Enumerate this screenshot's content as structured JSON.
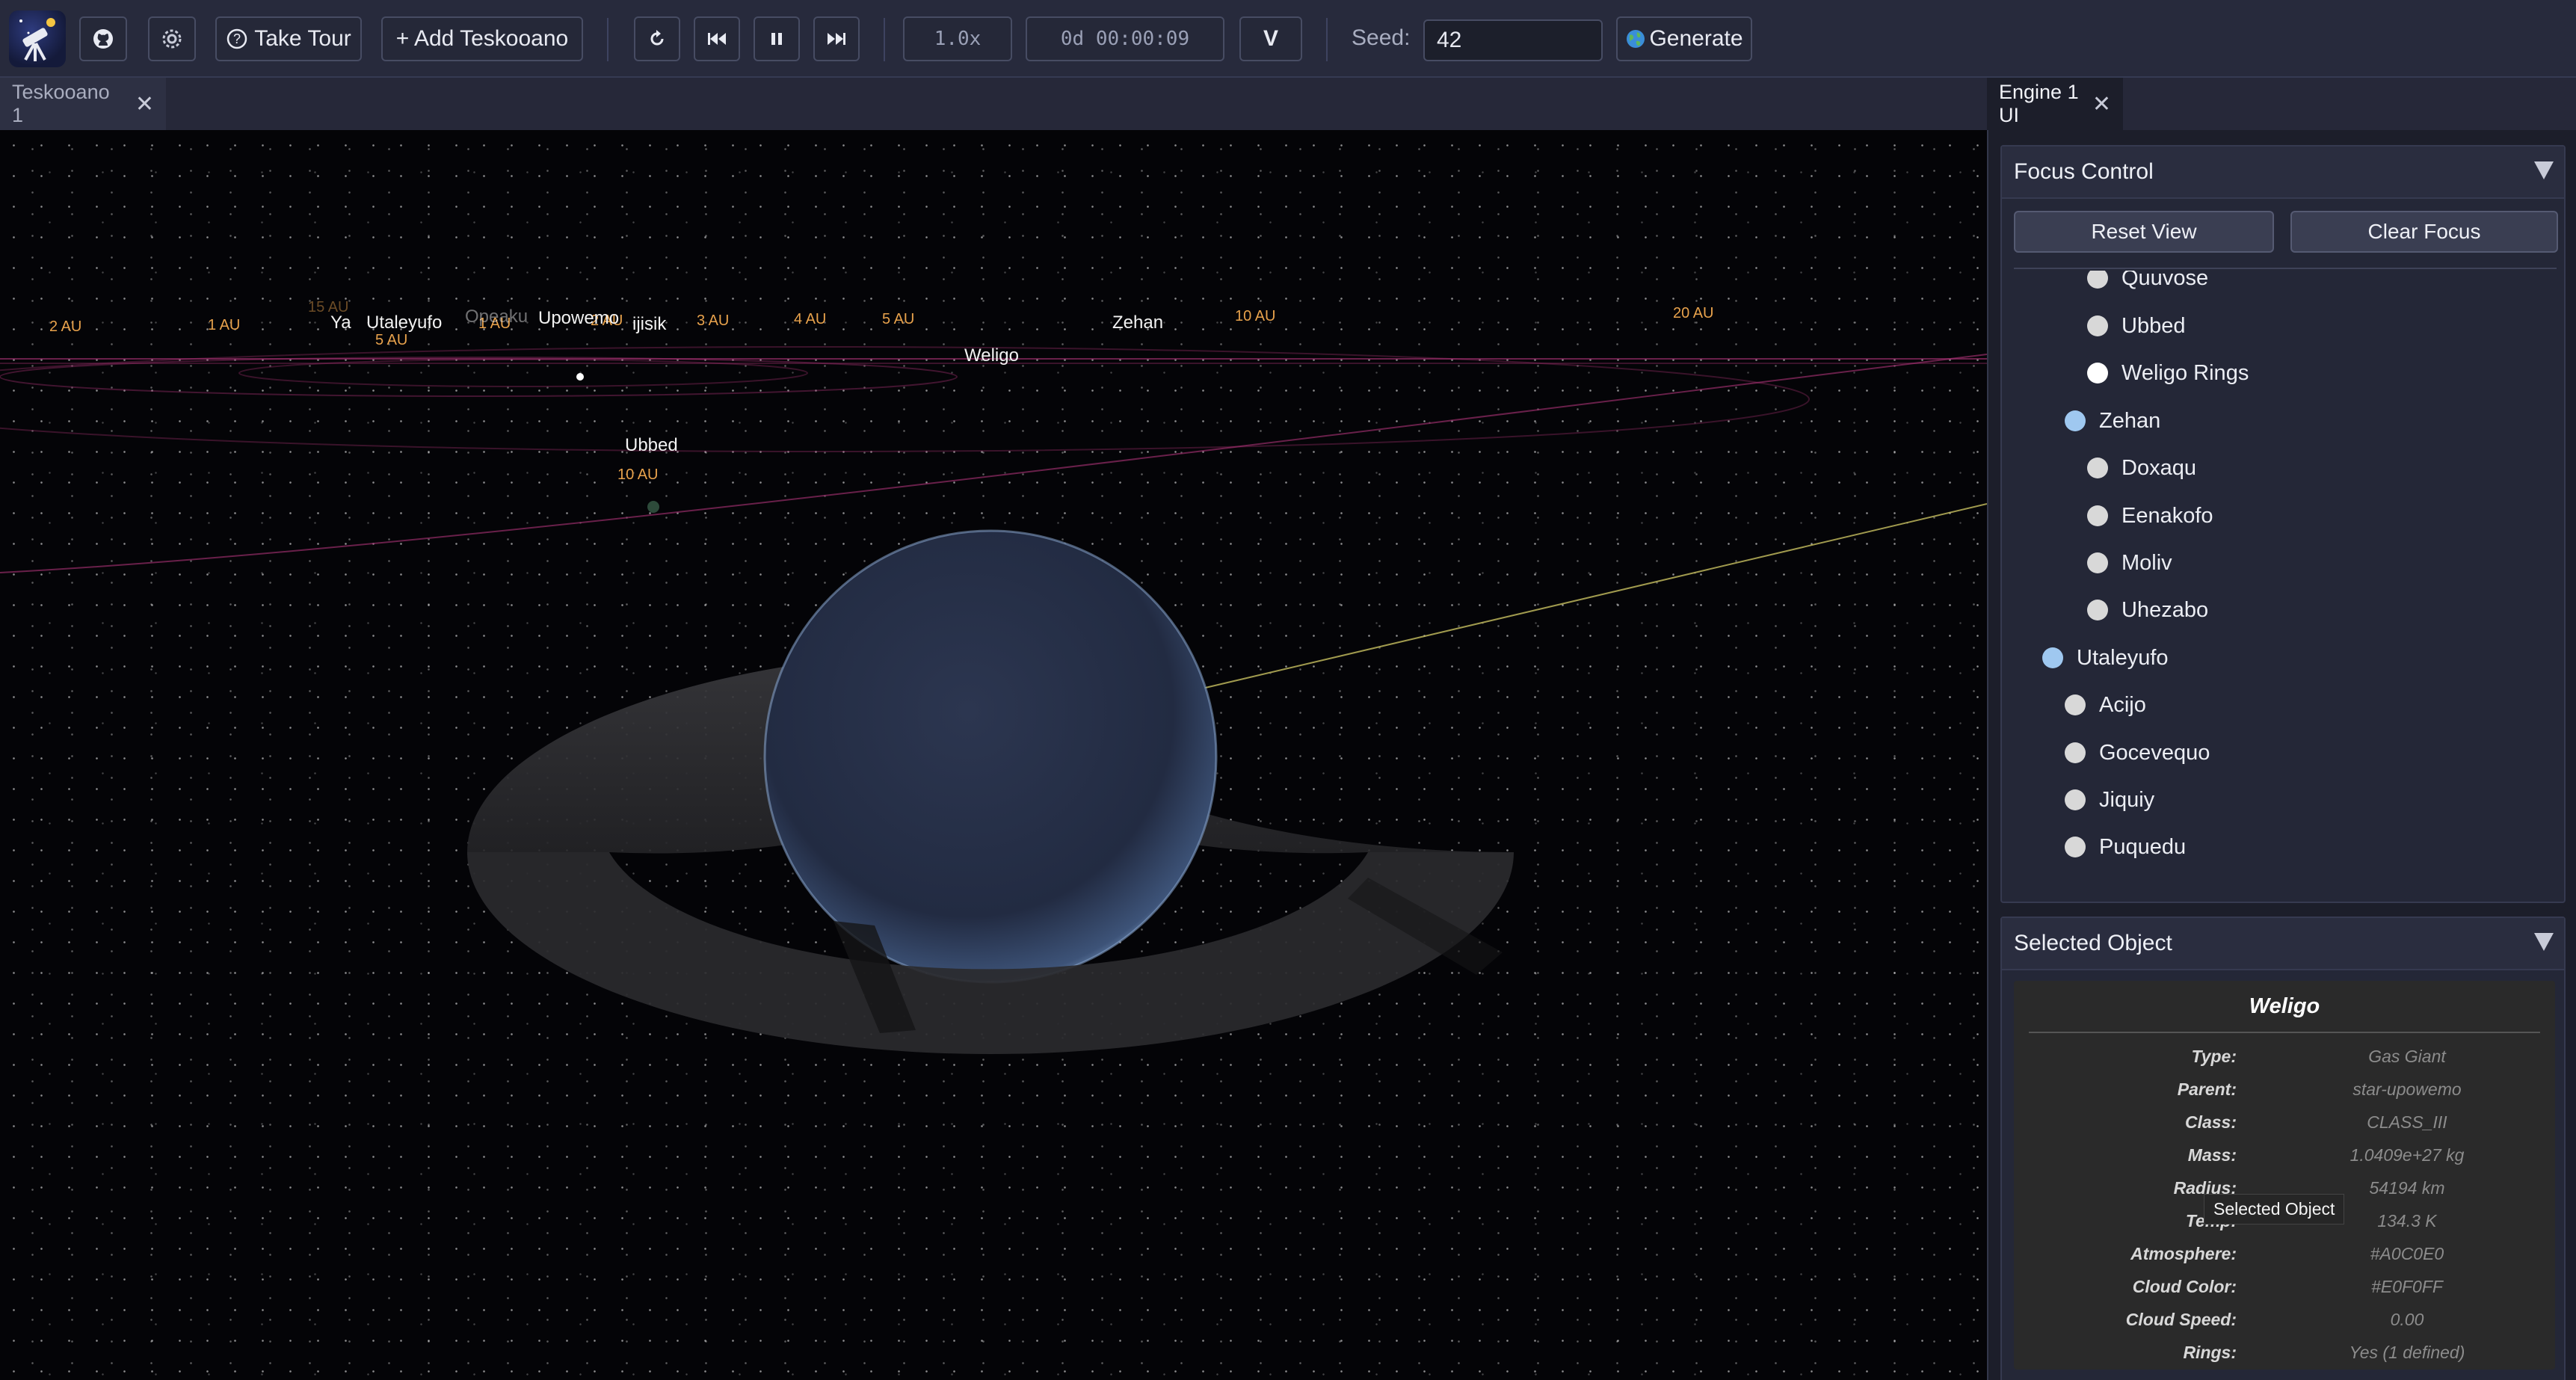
{
  "toolbar": {
    "logo_icon": "telescope-icon",
    "github_icon": "github-icon",
    "settings_icon": "gear-icon",
    "tour_icon": "question-circle-icon",
    "tour_label": "Take Tour",
    "add_label": "+ Add Teskooano",
    "reset_icon": "reset-icon",
    "prev_icon": "skip-back-icon",
    "pause_icon": "pause-icon",
    "next_icon": "skip-forward-icon",
    "speed": "1.0x",
    "sim_time": "0d 00:00:09",
    "v_label": "V",
    "seed_label": "Seed:",
    "seed_value": "42",
    "generate_icon": "globe-icon",
    "generate_label": "Generate"
  },
  "tabs": {
    "viewport_tab": "Teskooano 1",
    "panel_tab": "Engine 1 UI"
  },
  "viewport": {
    "planet_name": "Weligo",
    "labels": {
      "ya": "Ya",
      "utaleyufo": "Utaleyufo",
      "opeaku": "Opeaku",
      "upowemo": "Upowemo",
      "jjisik": "ijisik",
      "weligo": "Weligo",
      "zehan": "Zehan",
      "ubbed": "Ubbed"
    },
    "au_markers": [
      "2 AU",
      "1 AU",
      "15 AU",
      "5 AU",
      "1 AU",
      "2 AU",
      "3 AU",
      "4 AU",
      "5 AU",
      "10 AU",
      "20 AU",
      "10 AU"
    ]
  },
  "focus_control": {
    "title": "Focus Control",
    "reset_view": "Reset View",
    "clear_focus": "Clear Focus",
    "items": [
      {
        "label": "Quuvose",
        "dot": "#d8d8d8"
      },
      {
        "label": "Ubbed",
        "dot": "#d8d8d8"
      },
      {
        "label": "Weligo Rings",
        "dot": "#ffffff"
      },
      {
        "label": "Zehan",
        "dot": "#9fc8f0"
      },
      {
        "label": "Doxaqu",
        "dot": "#d8d8d8"
      },
      {
        "label": "Eenakofo",
        "dot": "#d8d8d8"
      },
      {
        "label": "Moliv",
        "dot": "#d8d8d8"
      },
      {
        "label": "Uhezabo",
        "dot": "#d8d8d8"
      },
      {
        "label": "Utaleyufo",
        "dot": "#9fc8f0"
      },
      {
        "label": "Acijo",
        "dot": "#d8d8d8"
      },
      {
        "label": "Gocevequo",
        "dot": "#d8d8d8"
      },
      {
        "label": "Jiquiy",
        "dot": "#d8d8d8"
      },
      {
        "label": "Puquedu",
        "dot": "#d8d8d8"
      }
    ]
  },
  "selected_object": {
    "title": "Selected Object",
    "name": "Weligo",
    "rows": [
      {
        "key": "Type:",
        "value": "Gas Giant"
      },
      {
        "key": "Parent:",
        "value": "star-upowemo"
      },
      {
        "key": "Class:",
        "value": "CLASS_III"
      },
      {
        "key": "Mass:",
        "value": "1.0409e+27 kg"
      },
      {
        "key": "Radius:",
        "value": "54194 km"
      },
      {
        "key": "Temp:",
        "value": "134.3 K"
      },
      {
        "key": "Atmosphere:",
        "value": "#A0C0E0"
      },
      {
        "key": "Cloud Color:",
        "value": "#E0F0FF"
      },
      {
        "key": "Cloud Speed:",
        "value": "0.00"
      },
      {
        "key": "Rings:",
        "value": "Yes (1 defined)"
      }
    ],
    "tooltip": "Selected Object"
  },
  "colors": {
    "accent": "#e8a24c",
    "orbit": "#a0306e",
    "planet": "#2a3552"
  }
}
